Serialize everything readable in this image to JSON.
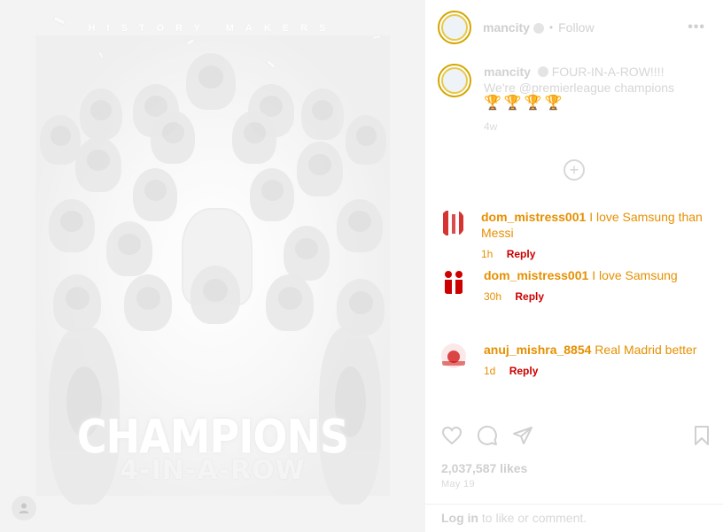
{
  "post": {
    "headline": "HISTORY MAKERS",
    "big_title": "CHAMPIONS",
    "big_subtitle": "4-IN-A-ROW"
  },
  "header": {
    "username": "mancity",
    "dot": "•",
    "follow_label": "Follow",
    "more_label": "•••"
  },
  "caption": {
    "username": "mancity",
    "line1": "FOUR-IN-A-ROW!!!!",
    "line2": "We're @premierleague champions",
    "emoji": "🏆🏆🏆🏆",
    "time": "4w"
  },
  "comments": [
    {
      "username": "dom_mistress001",
      "text": "I love Samsung than Messi",
      "time": "1h",
      "likes": "",
      "reply_label": "Reply"
    },
    {
      "username": "dom_mistress001",
      "text": "I love Samsung",
      "time": "30h",
      "likes": "",
      "reply_label": "Reply"
    },
    {
      "username": "anuj_mishra_8854",
      "text": "Real Madrid better",
      "time": "1d",
      "likes": "",
      "reply_label": "Reply"
    }
  ],
  "actions": {
    "likes_text": "2,037,587 likes",
    "date": "May 19"
  },
  "login": {
    "link_label": "Log in",
    "rest": " to like or comment."
  },
  "icons": {
    "heart": "heart-icon",
    "comment": "comment-icon",
    "share": "share-icon",
    "bookmark": "bookmark-icon",
    "add_more": "plus-circle-icon"
  },
  "colors": {
    "accent_yellow": "#d4a600",
    "comment_orange": "#e59000",
    "reply_red": "#cc0000"
  }
}
